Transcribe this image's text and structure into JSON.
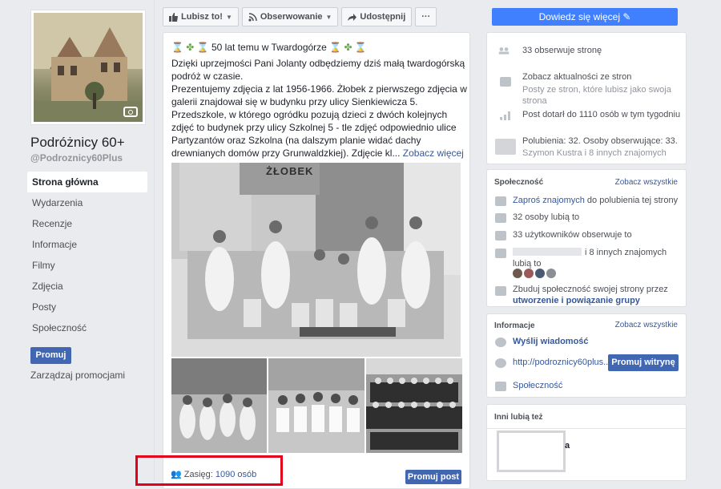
{
  "sidebar": {
    "page_name": "Podróżnicy 60+",
    "page_handle": "@Podroznicy60Plus",
    "nav": [
      {
        "label": "Strona główna"
      },
      {
        "label": "Wydarzenia"
      },
      {
        "label": "Recenzje"
      },
      {
        "label": "Informacje"
      },
      {
        "label": "Filmy"
      },
      {
        "label": "Zdjęcia"
      },
      {
        "label": "Posty"
      },
      {
        "label": "Społeczność"
      }
    ],
    "promote_label": "Promuj",
    "manage_promotions": "Zarządzaj promocjami"
  },
  "actions": {
    "like": "Lubisz to!",
    "follow": "Obserwowanie",
    "share": "Udostępnij",
    "more": "···",
    "learn_more": "Dowiedz się więcej"
  },
  "post": {
    "title": "50 lat temu w Twardogórze",
    "body": "Dzięki uprzejmości Pani Jolanty odbędziemy dziś małą twardogórską podróż w czasie.\nPrezentujemy zdjęcia z lat 1956-1966. Żłobek z pierwszego zdjęcia w galerii znajdował się w budynku przy ulicy Sienkiewicza 5. Przedszkole, w którego ogródku pozują dzieci z dwóch kolejnych zdjęć to budynek przy ulicy Szkolnej 5 - tle zdjęć odpowiednio ulice Partyzantów oraz Szkolna (na dalszym planie widać dachy drewnianych domów przy Grunwaldzkiej). Zdjęcie kl...",
    "see_more": "Zobacz więcej",
    "photo_sign": "ŻŁOBEK",
    "reach_label": "Zasięg:",
    "reach_value": "1090 osób",
    "promote_post": "Promuj post"
  },
  "stats": {
    "followers": "33 obserwuje stronę",
    "updates_title": "Zobacz aktualności ze stron",
    "updates_sub": "Posty ze stron, które lubisz jako swoja strona",
    "post_reach": "Post dotarł do 1110 osób w tym tygodniu",
    "likes_line": "Polubienia: 32. Osoby obserwujące: 33.",
    "likes_friends": "Szymon Kustra i 8 innych znajomych"
  },
  "community": {
    "header": "Społeczność",
    "see_all": "Zobacz wszystkie",
    "invite_link": "Zaproś znajomych",
    "invite_rest": " do polubienia tej strony",
    "likes": "32 osoby lubią to",
    "follows": "33 użytkowników obserwuje to",
    "friends_like": "i 8 innych znajomych lubią to",
    "build_text": "Zbuduj społeczność swojej strony przez",
    "build_link": "utworzenie i powiązanie grupy"
  },
  "info": {
    "header": "Informacje",
    "see_all": "Zobacz wszystkie",
    "message": "Wyślij wiadomość",
    "website": "http://podroznicy60plus...",
    "promote_site": "Promuj witrynę",
    "category": "Społeczność"
  },
  "others": {
    "header": "Inni lubią też",
    "item_letter": "a"
  },
  "colors": {
    "accent": "#4267b2",
    "learn_more": "#4080ff",
    "link": "#365899",
    "highlight": "#e3001b"
  }
}
